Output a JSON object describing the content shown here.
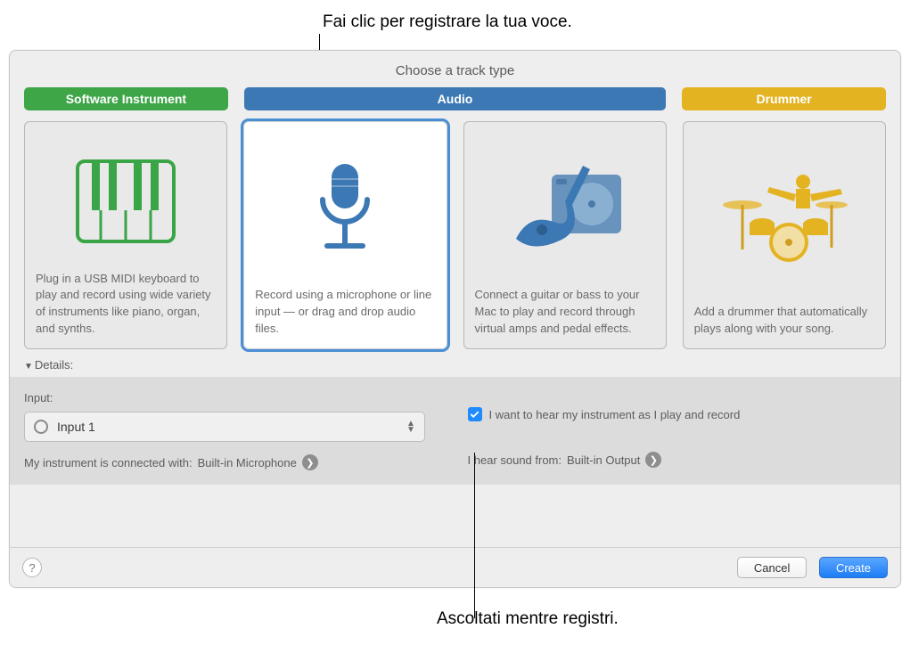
{
  "callouts": {
    "top": "Fai clic per registrare la tua voce.",
    "bottom": "Ascoltati mentre registri."
  },
  "title": "Choose a track type",
  "tabs": {
    "software": "Software Instrument",
    "audio": "Audio",
    "drummer": "Drummer"
  },
  "cards": {
    "software": "Plug in a USB MIDI keyboard to play and record using wide variety of instruments like piano, organ, and synths.",
    "mic": "Record using a microphone or line input — or drag and drop audio files.",
    "guitar": "Connect a guitar or bass to your Mac to play and record through virtual amps and pedal effects.",
    "drummer": "Add a drummer that automatically plays along with your song."
  },
  "details_label": "Details:",
  "input": {
    "label": "Input:",
    "value": "Input 1",
    "connected_prefix": "My instrument is connected with: ",
    "connected_value": "Built-in Microphone"
  },
  "monitor": {
    "checkbox_label": "I want to hear my instrument as I play and record",
    "checked": true,
    "hear_prefix": "I hear sound from: ",
    "hear_value": "Built-in Output"
  },
  "buttons": {
    "cancel": "Cancel",
    "create": "Create"
  },
  "colors": {
    "green": "#3fa648",
    "blue": "#3c78b4",
    "yellow": "#e3b322",
    "select": "#4a8fd6"
  }
}
